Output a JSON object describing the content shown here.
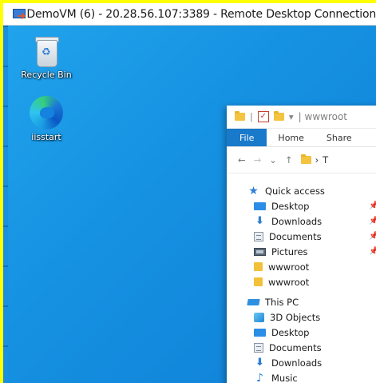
{
  "window": {
    "title": "DemoVM (6) - 20.28.56.107:3389 - Remote Desktop Connection"
  },
  "desktop": {
    "icons": [
      {
        "label": "Recycle Bin",
        "icon": "recycle-bin-icon"
      },
      {
        "label": "iisstart",
        "icon": "edge-browser-icon"
      }
    ]
  },
  "explorer": {
    "qat_title": "| wwwroot",
    "ribbon_tabs": [
      "File",
      "Home",
      "Share"
    ],
    "address_path_start": "T",
    "quick_access_label": "Quick access",
    "quick_access_items": [
      {
        "label": "Desktop",
        "icon": "desktop-folder-icon",
        "pinned": true
      },
      {
        "label": "Downloads",
        "icon": "downloads-icon",
        "pinned": true
      },
      {
        "label": "Documents",
        "icon": "documents-icon",
        "pinned": true
      },
      {
        "label": "Pictures",
        "icon": "pictures-icon",
        "pinned": true
      },
      {
        "label": "wwwroot",
        "icon": "folder-icon",
        "pinned": false
      },
      {
        "label": "wwwroot",
        "icon": "folder-icon",
        "pinned": false
      }
    ],
    "this_pc_label": "This PC",
    "this_pc_items": [
      {
        "label": "3D Objects",
        "icon": "3d-objects-icon"
      },
      {
        "label": "Desktop",
        "icon": "desktop-folder-icon"
      },
      {
        "label": "Documents",
        "icon": "documents-icon"
      },
      {
        "label": "Downloads",
        "icon": "downloads-icon"
      },
      {
        "label": "Music",
        "icon": "music-icon"
      }
    ]
  },
  "colors": {
    "frame_highlight": "#ffff00",
    "desktop_blue": "#1692e2",
    "ribbon_file_blue": "#1979ca"
  }
}
